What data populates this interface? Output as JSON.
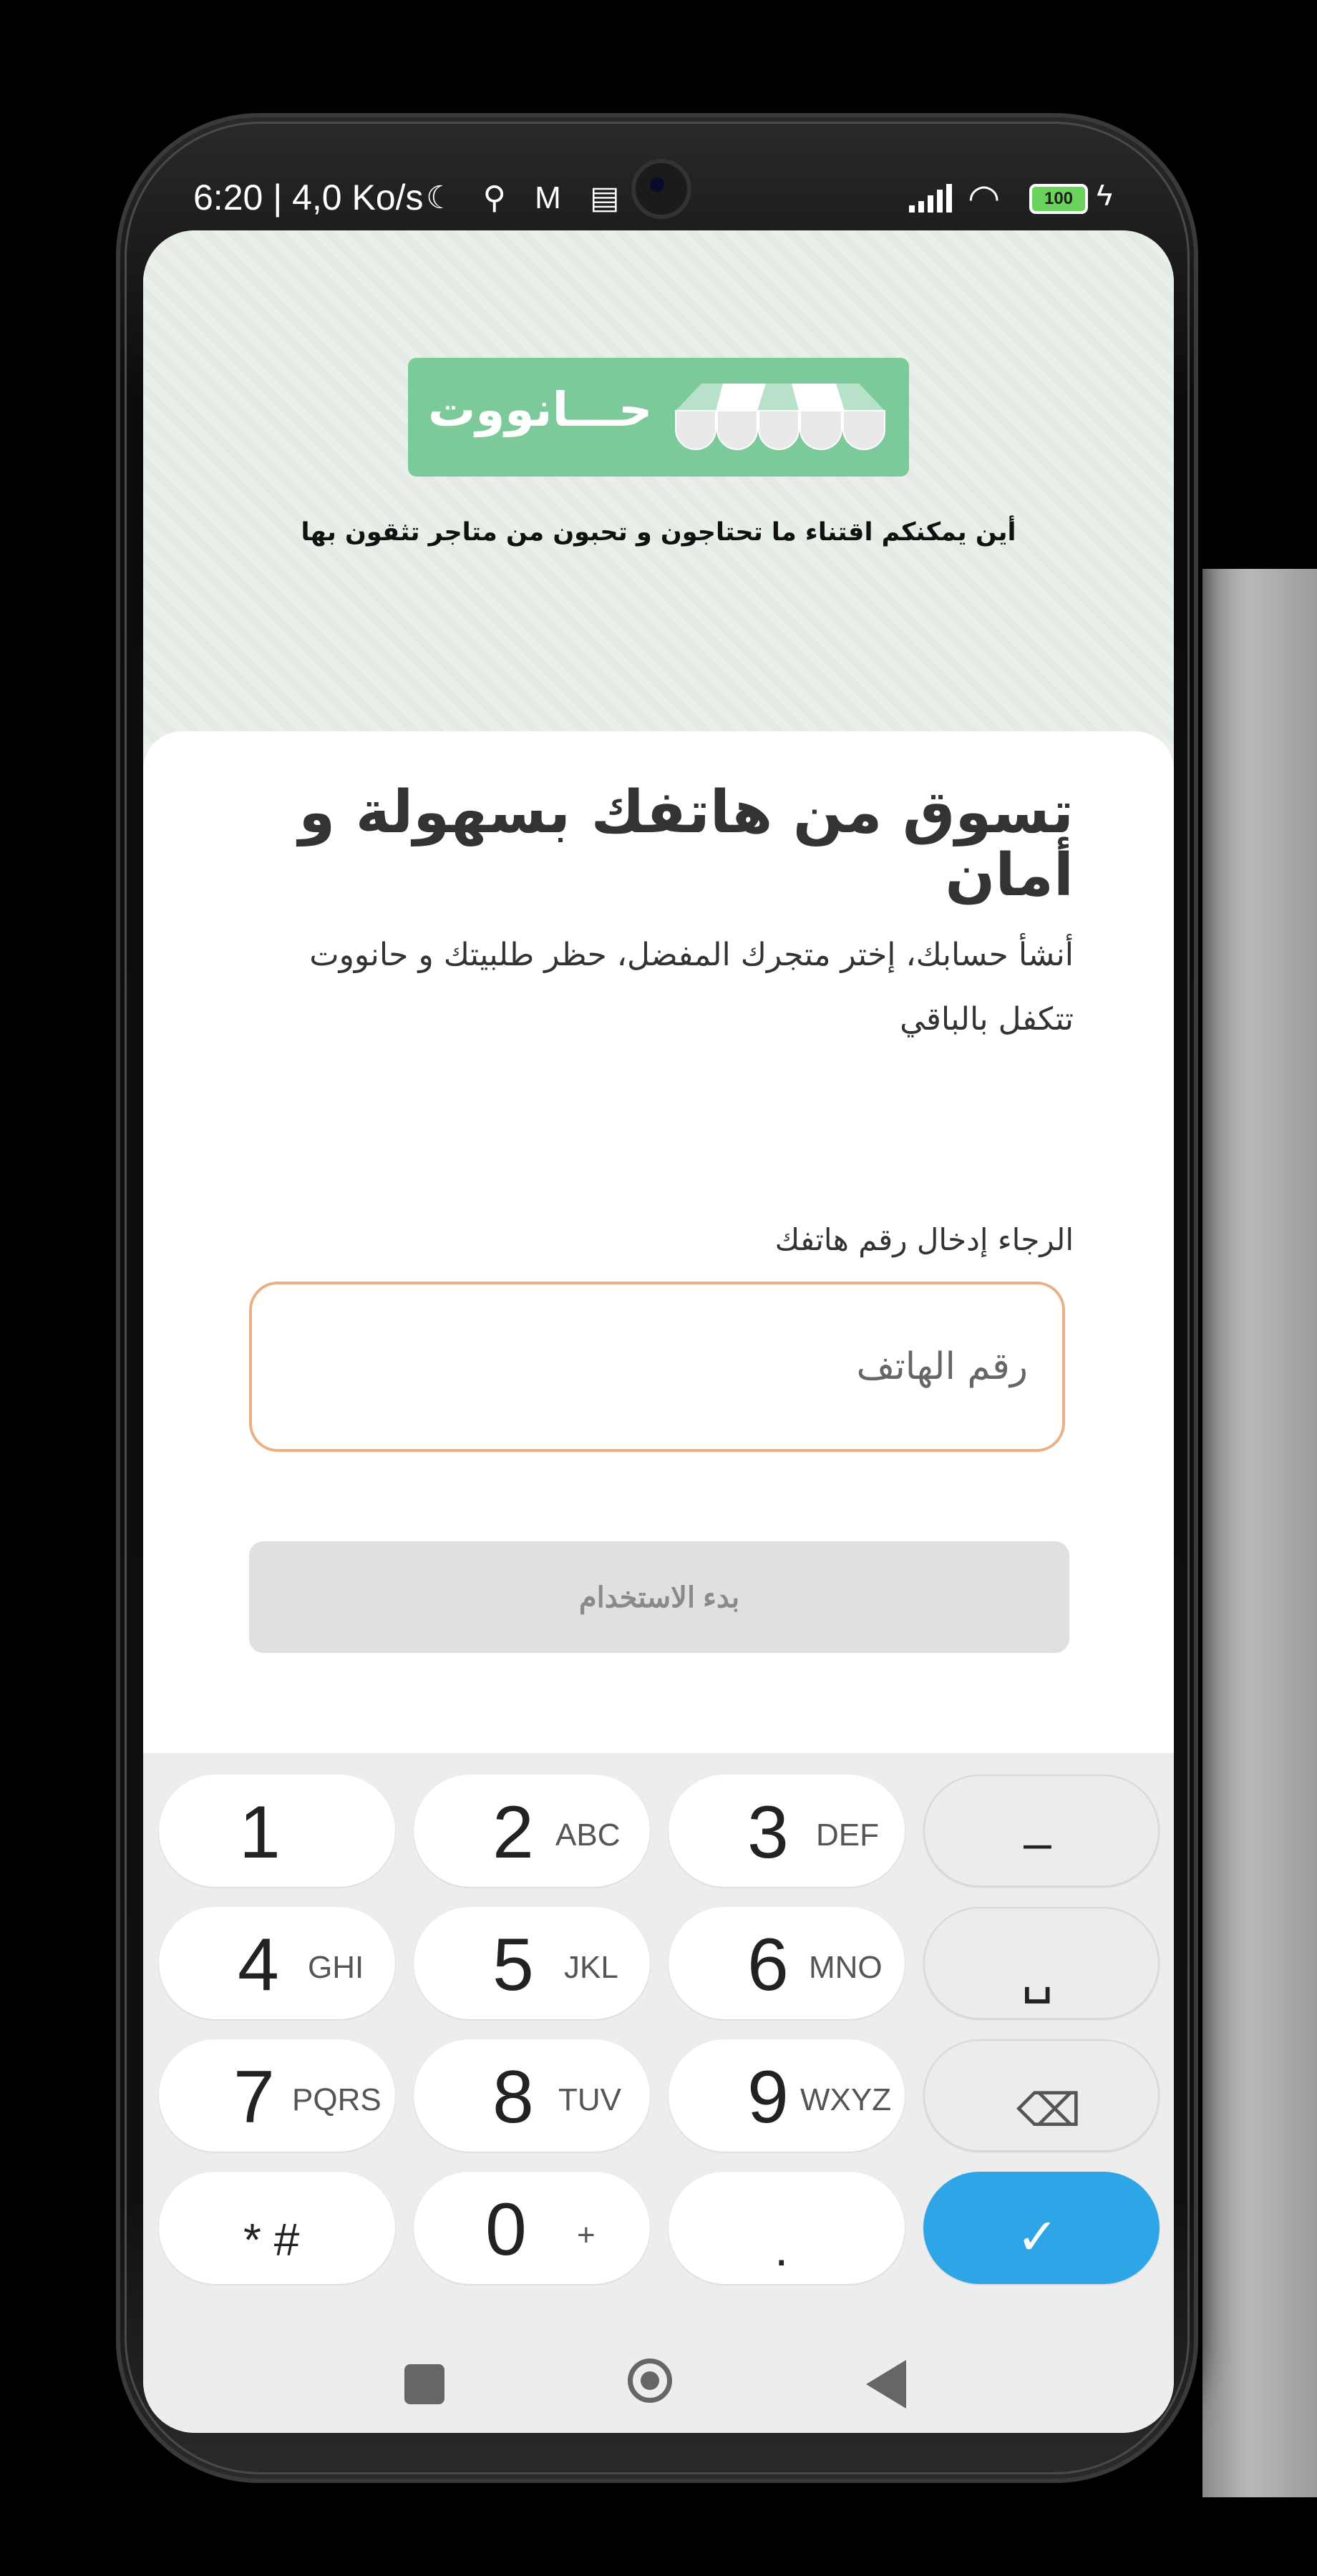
{
  "status_bar": {
    "time": "6:20 | 4,0 Ko/s",
    "icons": "☾ ⚲ M ▤",
    "battery": "100"
  },
  "app": {
    "logo_text": "حـــانووت",
    "tagline": "أين يمكنكم اقتناء ما تحتاجون و تحبون من متاجر تثقون بها",
    "headline": "تسوق من هاتفك بسهولة و أمان",
    "subtext": "أنشأ حسابك، إختر متجرك المفضل، حظر طلبيتك و حانووت تتكفل بالباقي",
    "phone_label": "الرجاء إدخال رقم هاتفك",
    "phone_placeholder": "رقم الهاتف",
    "start_button": "بدء الاستخدام"
  },
  "keypad": {
    "keys": [
      {
        "num": "1",
        "letters": ""
      },
      {
        "num": "2",
        "letters": "ABC"
      },
      {
        "num": "3",
        "letters": "DEF"
      },
      {
        "num": "–",
        "letters": ""
      },
      {
        "num": "4",
        "letters": "GHI"
      },
      {
        "num": "5",
        "letters": "JKL"
      },
      {
        "num": "6",
        "letters": "MNO"
      },
      {
        "num": "␣",
        "letters": ""
      },
      {
        "num": "7",
        "letters": "PQRS"
      },
      {
        "num": "8",
        "letters": "TUV"
      },
      {
        "num": "9",
        "letters": "WXYZ"
      },
      {
        "num": "⌫",
        "letters": ""
      },
      {
        "num": "* #",
        "letters": ""
      },
      {
        "num": "0",
        "letters": "+"
      },
      {
        "num": ".",
        "letters": ""
      },
      {
        "num": "✓",
        "letters": ""
      }
    ]
  },
  "colors": {
    "logo_green": "#7cc99a",
    "input_border": "#eab084",
    "confirm_blue": "#2ea5e6"
  }
}
